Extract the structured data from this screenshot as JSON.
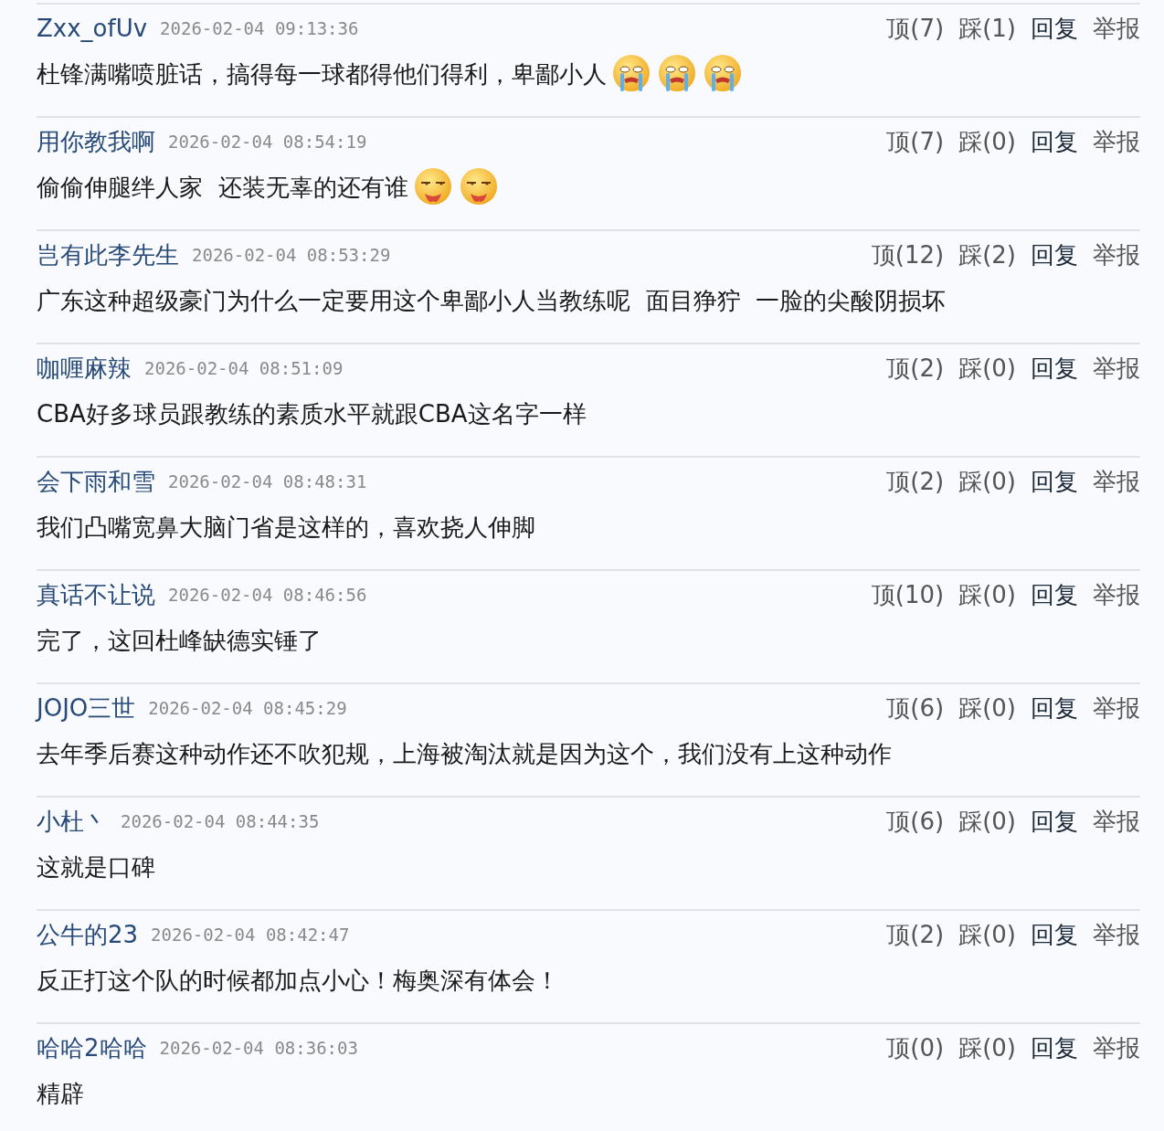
{
  "comments": [
    {
      "user": "Zxx_ofUv",
      "time": "2026-02-04 09:13:36",
      "up": "顶(7)",
      "down": "踩(1)",
      "reply": "回复",
      "report": "举报",
      "text": "杜锋满嘴喷脏话，搞得每一球都得他们得利，卑鄙小人",
      "emoji": [
        {
          "kind": "crying"
        },
        {
          "kind": "crying"
        },
        {
          "kind": "crying"
        }
      ]
    },
    {
      "user": "用你教我啊",
      "time": "2026-02-04 08:54:19",
      "up": "顶(7)",
      "down": "踩(0)",
      "reply": "回复",
      "report": "举报",
      "text": "偷偷伸腿绊人家  还装无辜的还有谁",
      "emoji": [
        {
          "kind": "smirk"
        },
        {
          "kind": "smirk"
        }
      ]
    },
    {
      "user": "岂有此李先生",
      "time": "2026-02-04 08:53:29",
      "up": "顶(12)",
      "down": "踩(2)",
      "reply": "回复",
      "report": "举报",
      "text": "广东这种超级豪门为什么一定要用这个卑鄙小人当教练呢  面目狰狞  一脸的尖酸阴损坏"
    },
    {
      "user": "咖喱麻辣",
      "time": "2026-02-04 08:51:09",
      "up": "顶(2)",
      "down": "踩(0)",
      "reply": "回复",
      "report": "举报",
      "text": "CBA好多球员跟教练的素质水平就跟CBA这名字一样"
    },
    {
      "user": "会下雨和雪",
      "time": "2026-02-04 08:48:31",
      "up": "顶(2)",
      "down": "踩(0)",
      "reply": "回复",
      "report": "举报",
      "text": "我们凸嘴宽鼻大脑门省是这样的，喜欢挠人伸脚"
    },
    {
      "user": "真话不让说",
      "time": "2026-02-04 08:46:56",
      "up": "顶(10)",
      "down": "踩(0)",
      "reply": "回复",
      "report": "举报",
      "text": "完了，这回杜峰缺德实锤了"
    },
    {
      "user": "JOJO三世",
      "time": "2026-02-04 08:45:29",
      "up": "顶(6)",
      "down": "踩(0)",
      "reply": "回复",
      "report": "举报",
      "text": "去年季后赛这种动作还不吹犯规，上海被淘汰就是因为这个，我们没有上这种动作"
    },
    {
      "user": "小杜丶",
      "time": "2026-02-04 08:44:35",
      "up": "顶(6)",
      "down": "踩(0)",
      "reply": "回复",
      "report": "举报",
      "text": "这就是口碑"
    },
    {
      "user": "公牛的23",
      "time": "2026-02-04 08:42:47",
      "up": "顶(2)",
      "down": "踩(0)",
      "reply": "回复",
      "report": "举报",
      "text": "反正打这个队的时候都加点小心！梅奥深有体会！"
    },
    {
      "user": "哈哈2哈哈",
      "time": "2026-02-04 08:36:03",
      "up": "顶(0)",
      "down": "踩(0)",
      "reply": "回复",
      "report": "举报",
      "text": "精辟"
    }
  ]
}
